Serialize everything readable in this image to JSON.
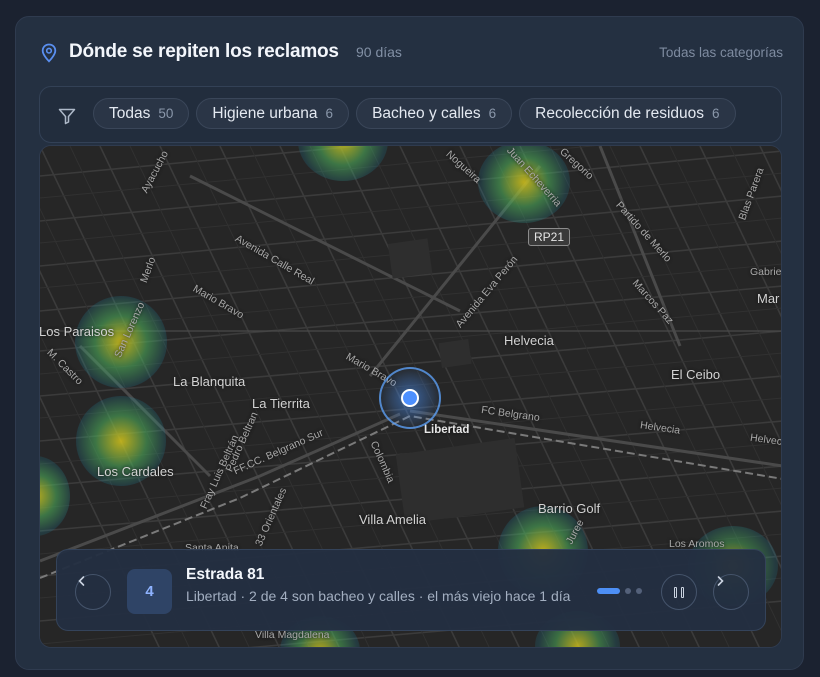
{
  "header": {
    "title": "Dónde se repiten los reclamos",
    "period": "90 días",
    "all_categories": "Todas las categorías"
  },
  "filters": {
    "icon": "filter-icon",
    "chips": [
      {
        "label": "Todas",
        "count": "50"
      },
      {
        "label": "Higiene urbana",
        "count": "6"
      },
      {
        "label": "Bacheo y calles",
        "count": "6"
      },
      {
        "label": "Recolección de residuos",
        "count": "6"
      }
    ]
  },
  "map": {
    "road_badge": "RP21",
    "labels": {
      "ayacucho": "Ayacucho",
      "nogueira": "Nogueira",
      "juan_echeverria": "Juan Echeverria",
      "gregorio": "Gregorio",
      "blas_parera": "Blas Parera",
      "partido_de_merlo": "Partido de Merlo",
      "marcos_paz": "Marcos Paz",
      "gabriel": "Gabrie",
      "mar": "Mar",
      "avenida_calle_real": "Avenida Calle Real",
      "merlo": "Merlo",
      "mario_bravo_1": "Mario Bravo",
      "avenida_eva_peron": "Avenida Eva Perón",
      "los_paraisos": "Los Paraisos",
      "san_lorenzo": "San Lorenzo",
      "m_castro": "M. Castro",
      "helvecia_1": "Helvecia",
      "mario_bravo_2": "Mario Bravo",
      "la_blanquita": "La Blanquita",
      "el_ceibo": "El Ceibo",
      "la_tierrita": "La Tierrita",
      "fc_belgrano_1": "FC Belgrano",
      "libertad": "Libertad",
      "helvecia_2": "Helvecia",
      "helvecia_3": "Helveci",
      "pedro_beltran": "Pedro Beltran",
      "ffcc_belgrano_sur": "FF.CC. Belgrano Sur",
      "colombia": "Colombia",
      "los_cardales": "Los Cardales",
      "fray_luis_beltran": "Fray Luis Beltrán",
      "orientales": "33 Orientales",
      "barrio_golf": "Barrio Golf",
      "villa_amelia": "Villa Amelia",
      "juree": "Juree",
      "los_aromos": "Los Aromos",
      "santa_anita": "Santa Anita",
      "villa_magdalena": "Villa Magdalena"
    }
  },
  "panel": {
    "prev_icon": "chevron-left-icon",
    "next_icon": "chevron-right-icon",
    "pause_icon": "pause-icon",
    "badge_count": "4",
    "title": "Estrada 81",
    "subtitle": "Libertad · 2 de 4 son bacheo y calles · el más viejo hace 1 día",
    "pager": {
      "current": 1,
      "total": 3
    }
  },
  "colors": {
    "accent": "#4d8ff5",
    "heat_core": "#d4c31b",
    "heat_mid": "#4caa5a",
    "heat_edge": "#1e8fa8"
  }
}
